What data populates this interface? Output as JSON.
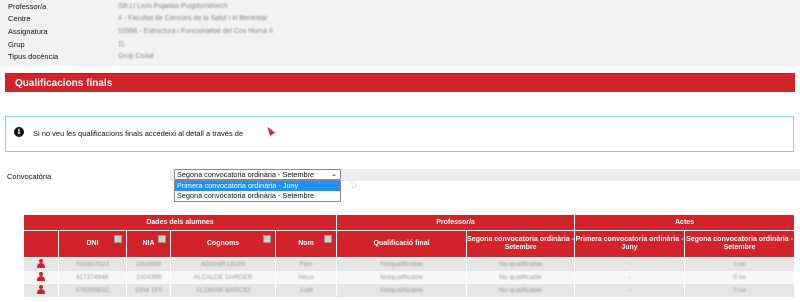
{
  "info": [
    {
      "label": "Professor/a",
      "value": "Sllt.Ll Lluís Pujadas Puigdomènech"
    },
    {
      "label": "Centre",
      "value": "4 - Facultat de Ciències de la Salut i el Benestar"
    },
    {
      "label": "Assignatura",
      "value": "10996 - Estructura i Funcionalitat del Cos Humà II"
    },
    {
      "label": "Grup",
      "value": "1L"
    },
    {
      "label": "Tipus docència",
      "value": "Grup Ciutat"
    }
  ],
  "section": {
    "title": "Qualificacions finals"
  },
  "notice": {
    "icon": "info-icon",
    "text": "Si no veu les qualificacions finals accedeixi al detall a través de"
  },
  "convocatoria": {
    "label": "Convocatòria",
    "selected": "Segona convocatoria ordinària - Setembre",
    "options": [
      "Primera convocatoria ordinària - Juny",
      "Segona convocatoria ordinària - Setembre"
    ]
  },
  "table": {
    "groups": [
      "Dades dels alumnes",
      "Professor/a",
      "Actes"
    ],
    "columns": {
      "dni": "DNI",
      "nia": "NIA",
      "cognoms": "Cognoms",
      "nom": "Nom",
      "qf": "Qualificació final",
      "seg_prof": "Segona convocatoria ordinària - Setembre",
      "prim_act": "Primera convocatoria ordinària - Juny",
      "seg_act": "Segona convocatoria ordinària - Setembre"
    },
    "rows": [
      {
        "dni": "53330752J",
        "nia": "1004998",
        "cognoms": "ADAHIR LEON",
        "nom": "Flen",
        "qf": "Notqualificable",
        "seg_prof": "No qualificable",
        "prim_act": "-",
        "seg_act": "0 no"
      },
      {
        "dni": "41737494K",
        "nia": "1004399",
        "cognoms": "ALCALDE DARDER",
        "nom": "Neus",
        "qf": "Notqualificable",
        "seg_prof": "No qualificable",
        "prim_act": "-",
        "seg_act": "0 no"
      },
      {
        "dni": "47638983C",
        "nia": "1004 1F5",
        "cognoms": "ALOMAR BARCIO",
        "nom": "Judit",
        "qf": "Notqualificable",
        "seg_prof": "No qualificable",
        "prim_act": "-",
        "seg_act": "0 no"
      }
    ]
  },
  "colors": {
    "accent": "#d2232a",
    "notice_border": "#7fd6e0",
    "selected_option": "#1e90ff"
  }
}
